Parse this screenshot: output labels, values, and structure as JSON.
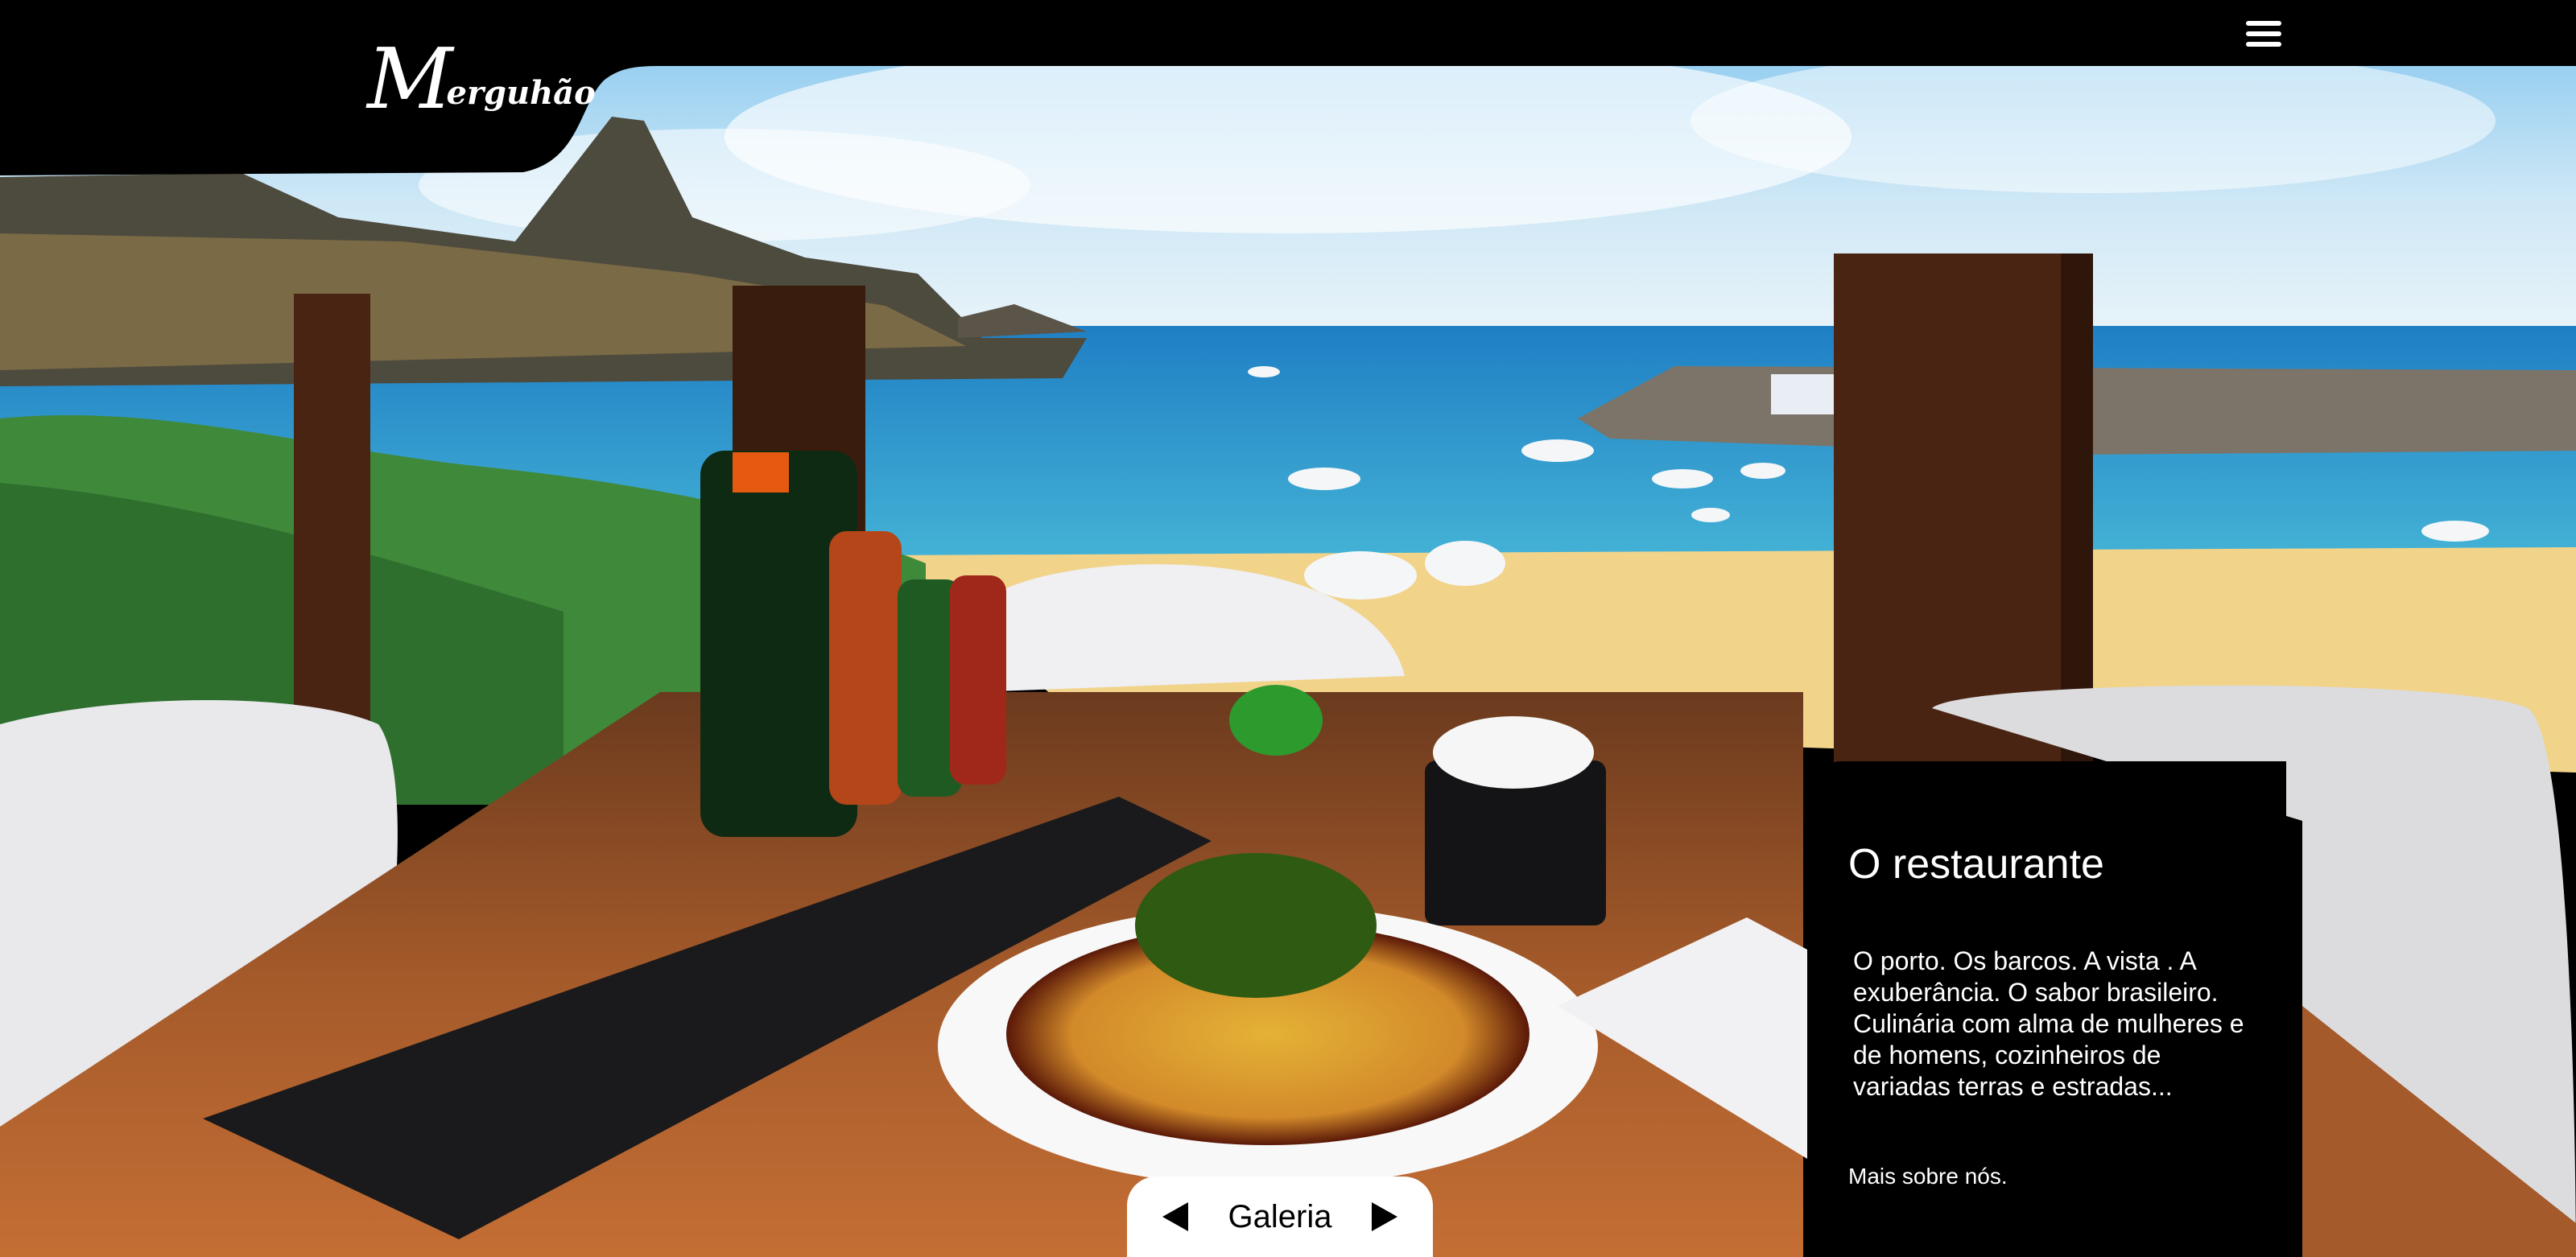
{
  "brand": {
    "logo_initial": "M",
    "logo_rest": "erguhão"
  },
  "header": {
    "menu_icon": "hamburger-menu-icon"
  },
  "card": {
    "title": "O restaurante",
    "text": "O porto. Os barcos. A vista . A exuberância. O sabor brasileiro. Culinária com alma de mulheres e de homens, cozinheiros de variadas terras e estradas...",
    "link": "Mais sobre nós."
  },
  "gallery": {
    "label": "Galeria",
    "prev_icon": "triangle-left-icon",
    "next_icon": "triangle-right-icon"
  },
  "colors": {
    "bar": "#000000",
    "card": "#000000",
    "pill": "#ffffff"
  }
}
